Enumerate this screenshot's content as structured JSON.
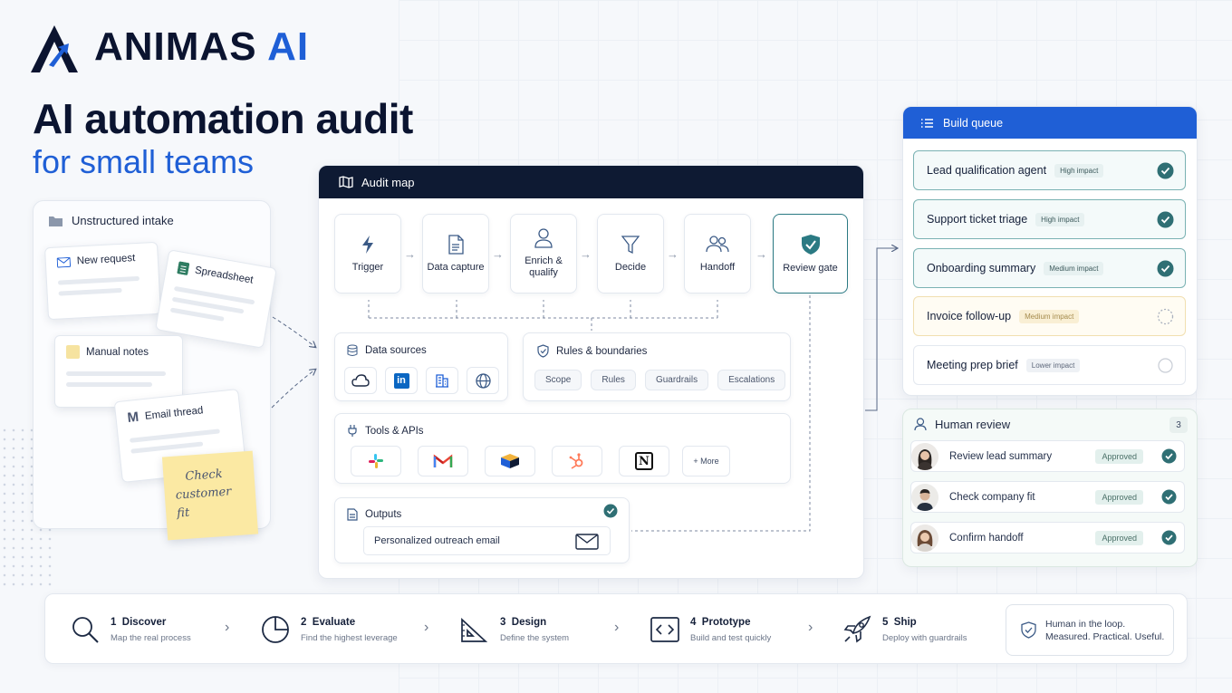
{
  "brand": {
    "name_main": "ANIMAS",
    "name_accent": "AI"
  },
  "headline": "AI automation audit",
  "subheadline": "for small teams",
  "intake": {
    "title": "Unstructured intake",
    "notes": [
      "New request",
      "Spreadsheet",
      "Manual notes",
      "Email thread"
    ],
    "sticky": [
      "Check",
      "customer fit"
    ]
  },
  "audit_map": {
    "title": "Audit map",
    "steps": [
      {
        "label": "Trigger",
        "icon": "lightning-icon"
      },
      {
        "label": "Data capture",
        "icon": "document-icon"
      },
      {
        "label": "Enrich &",
        "label2": "qualify",
        "icon": "person-icon"
      },
      {
        "label": "Decide",
        "icon": "filter-icon"
      },
      {
        "label": "Handoff",
        "icon": "people-icon"
      },
      {
        "label": "Review gate",
        "icon": "shield-check-icon"
      }
    ],
    "data_sources": {
      "title": "Data sources",
      "icons": [
        "cloud-icon",
        "linkedin-icon",
        "building-icon",
        "globe-icon"
      ]
    },
    "rules": {
      "title": "Rules & boundaries",
      "chips": [
        "Scope",
        "Rules",
        "Guardrails",
        "Escalations"
      ]
    },
    "tools": {
      "title": "Tools & APIs",
      "icons": [
        "slack-icon",
        "gmail-icon",
        "box-icon",
        "hubspot-icon",
        "notion-icon"
      ],
      "more": "+ More"
    },
    "outputs": {
      "title": "Outputs",
      "value": "Personalized outreach email"
    }
  },
  "build_queue": {
    "title": "Build queue",
    "items": [
      {
        "label": "Lead qualification agent",
        "impact": "High impact",
        "state": "done"
      },
      {
        "label": "Support ticket triage",
        "impact": "High impact",
        "state": "done"
      },
      {
        "label": "Onboarding summary",
        "impact": "Medium impact",
        "state": "done"
      },
      {
        "label": "Invoice follow-up",
        "impact": "Medium impact",
        "state": "in-progress"
      },
      {
        "label": "Meeting prep brief",
        "impact": "Lower impact",
        "state": "todo"
      }
    ]
  },
  "human_review": {
    "title": "Human review",
    "count": "3",
    "items": [
      {
        "label": "Review lead summary",
        "status": "Approved"
      },
      {
        "label": "Check company fit",
        "status": "Approved"
      },
      {
        "label": "Confirm handoff",
        "status": "Approved"
      }
    ]
  },
  "process": [
    {
      "num": "1",
      "title": "Discover",
      "desc": "Map the real process",
      "icon": "magnifier-icon"
    },
    {
      "num": "2",
      "title": "Evaluate",
      "desc": "Find the highest leverage",
      "icon": "pie-chart-icon"
    },
    {
      "num": "3",
      "title": "Design",
      "desc": "Define the system",
      "icon": "set-square-icon"
    },
    {
      "num": "4",
      "title": "Prototype",
      "desc": "Build and test quickly",
      "icon": "code-icon"
    },
    {
      "num": "5",
      "title": "Ship",
      "desc": "Deploy with guardrails",
      "icon": "rocket-icon"
    }
  ],
  "tagline": {
    "line1": "Human in the loop.",
    "line2": "Measured. Practical. Useful."
  },
  "colors": {
    "brand_blue": "#1f5fd6",
    "navy": "#0e1a33",
    "teal": "#2b7a83",
    "check": "#2f6f74"
  }
}
